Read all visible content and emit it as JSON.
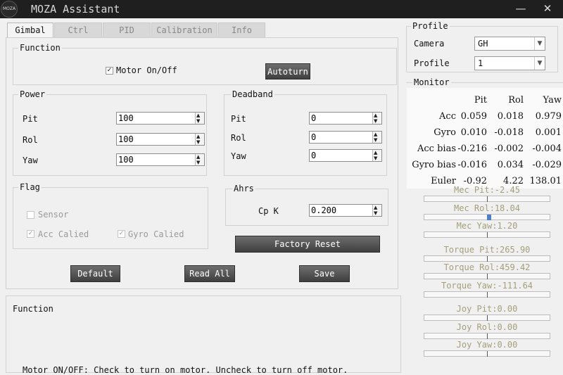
{
  "window": {
    "title": "MOZA Assistant",
    "logo_text": "MOZA"
  },
  "tabs": [
    {
      "label": "Gimbal",
      "active": true
    },
    {
      "label": "Ctrl",
      "active": false
    },
    {
      "label": "PID",
      "active": false
    },
    {
      "label": "Calibration",
      "active": false
    },
    {
      "label": "Info",
      "active": false
    }
  ],
  "function_group": {
    "legend": "Function",
    "motor_label": "Motor On/Off",
    "motor_checked": true,
    "autoturn_label": "Autoturn"
  },
  "power": {
    "legend": "Power",
    "rows": [
      {
        "label": "Pit",
        "value": "100"
      },
      {
        "label": "Rol",
        "value": "100"
      },
      {
        "label": "Yaw",
        "value": "100"
      }
    ]
  },
  "deadband": {
    "legend": "Deadband",
    "rows": [
      {
        "label": "Pit",
        "value": "0"
      },
      {
        "label": "Rol",
        "value": "0"
      },
      {
        "label": "Yaw",
        "value": "0"
      }
    ]
  },
  "flag": {
    "legend": "Flag",
    "sensor": "Sensor",
    "acc": "Acc Calied",
    "gyro": "Gyro Calied"
  },
  "ahrs": {
    "legend": "Ahrs",
    "label": "Cp K",
    "value": "0.200"
  },
  "buttons": {
    "factory_reset": "Factory Reset",
    "default": "Default",
    "read_all": "Read All",
    "save": "Save"
  },
  "help": {
    "legend": "Function",
    "text_partial": "Motor ON/OFF: Check to turn on motor. Uncheck to turn off motor."
  },
  "profile": {
    "legend": "Profile",
    "camera_label": "Camera",
    "camera_value": "GH",
    "profile_label": "Profile",
    "profile_value": "1"
  },
  "monitor": {
    "legend": "Monitor",
    "columns": [
      "Pit",
      "Rol",
      "Yaw"
    ],
    "rows": [
      {
        "label": "Acc",
        "pit": "0.059",
        "rol": "0.018",
        "yaw": "0.979"
      },
      {
        "label": "Gyro",
        "pit": "0.010",
        "rol": "-0.018",
        "yaw": "0.001"
      },
      {
        "label": "Acc bias",
        "pit": "-0.216",
        "rol": "-0.002",
        "yaw": "-0.004"
      },
      {
        "label": "Gyro bias",
        "pit": "-0.016",
        "rol": "0.034",
        "yaw": "-0.029"
      },
      {
        "label": "Euler",
        "pit": "-0.92",
        "rol": "4.22",
        "yaw": "138.01"
      }
    ]
  },
  "bars": [
    {
      "label": "Mec Pit:-2.45",
      "value": -2.45,
      "thumb": false
    },
    {
      "label": "Mec Rol:18.04",
      "value": 18.04,
      "thumb": true
    },
    {
      "label": "Mec Yaw:1.20",
      "value": 1.2,
      "thumb": false
    },
    {
      "label": "Torque Pit:265.90",
      "value": 265.9,
      "thumb": false
    },
    {
      "label": "Torque Rol:459.42",
      "value": 459.42,
      "thumb": false
    },
    {
      "label": "Torque Yaw:-111.64",
      "value": -111.64,
      "thumb": false
    },
    {
      "label": "Joy Pit:0.00",
      "value": 0,
      "thumb": false
    },
    {
      "label": "Joy Rol:0.00",
      "value": 0,
      "thumb": false
    },
    {
      "label": "Joy Yaw:0.00",
      "value": 0,
      "thumb": false
    }
  ],
  "colors": {
    "titlebar": "#1f1f1f",
    "bar_label": "#a49f7a",
    "button_dark": "#3f3f3f",
    "thumb": "#4d7ec8"
  }
}
